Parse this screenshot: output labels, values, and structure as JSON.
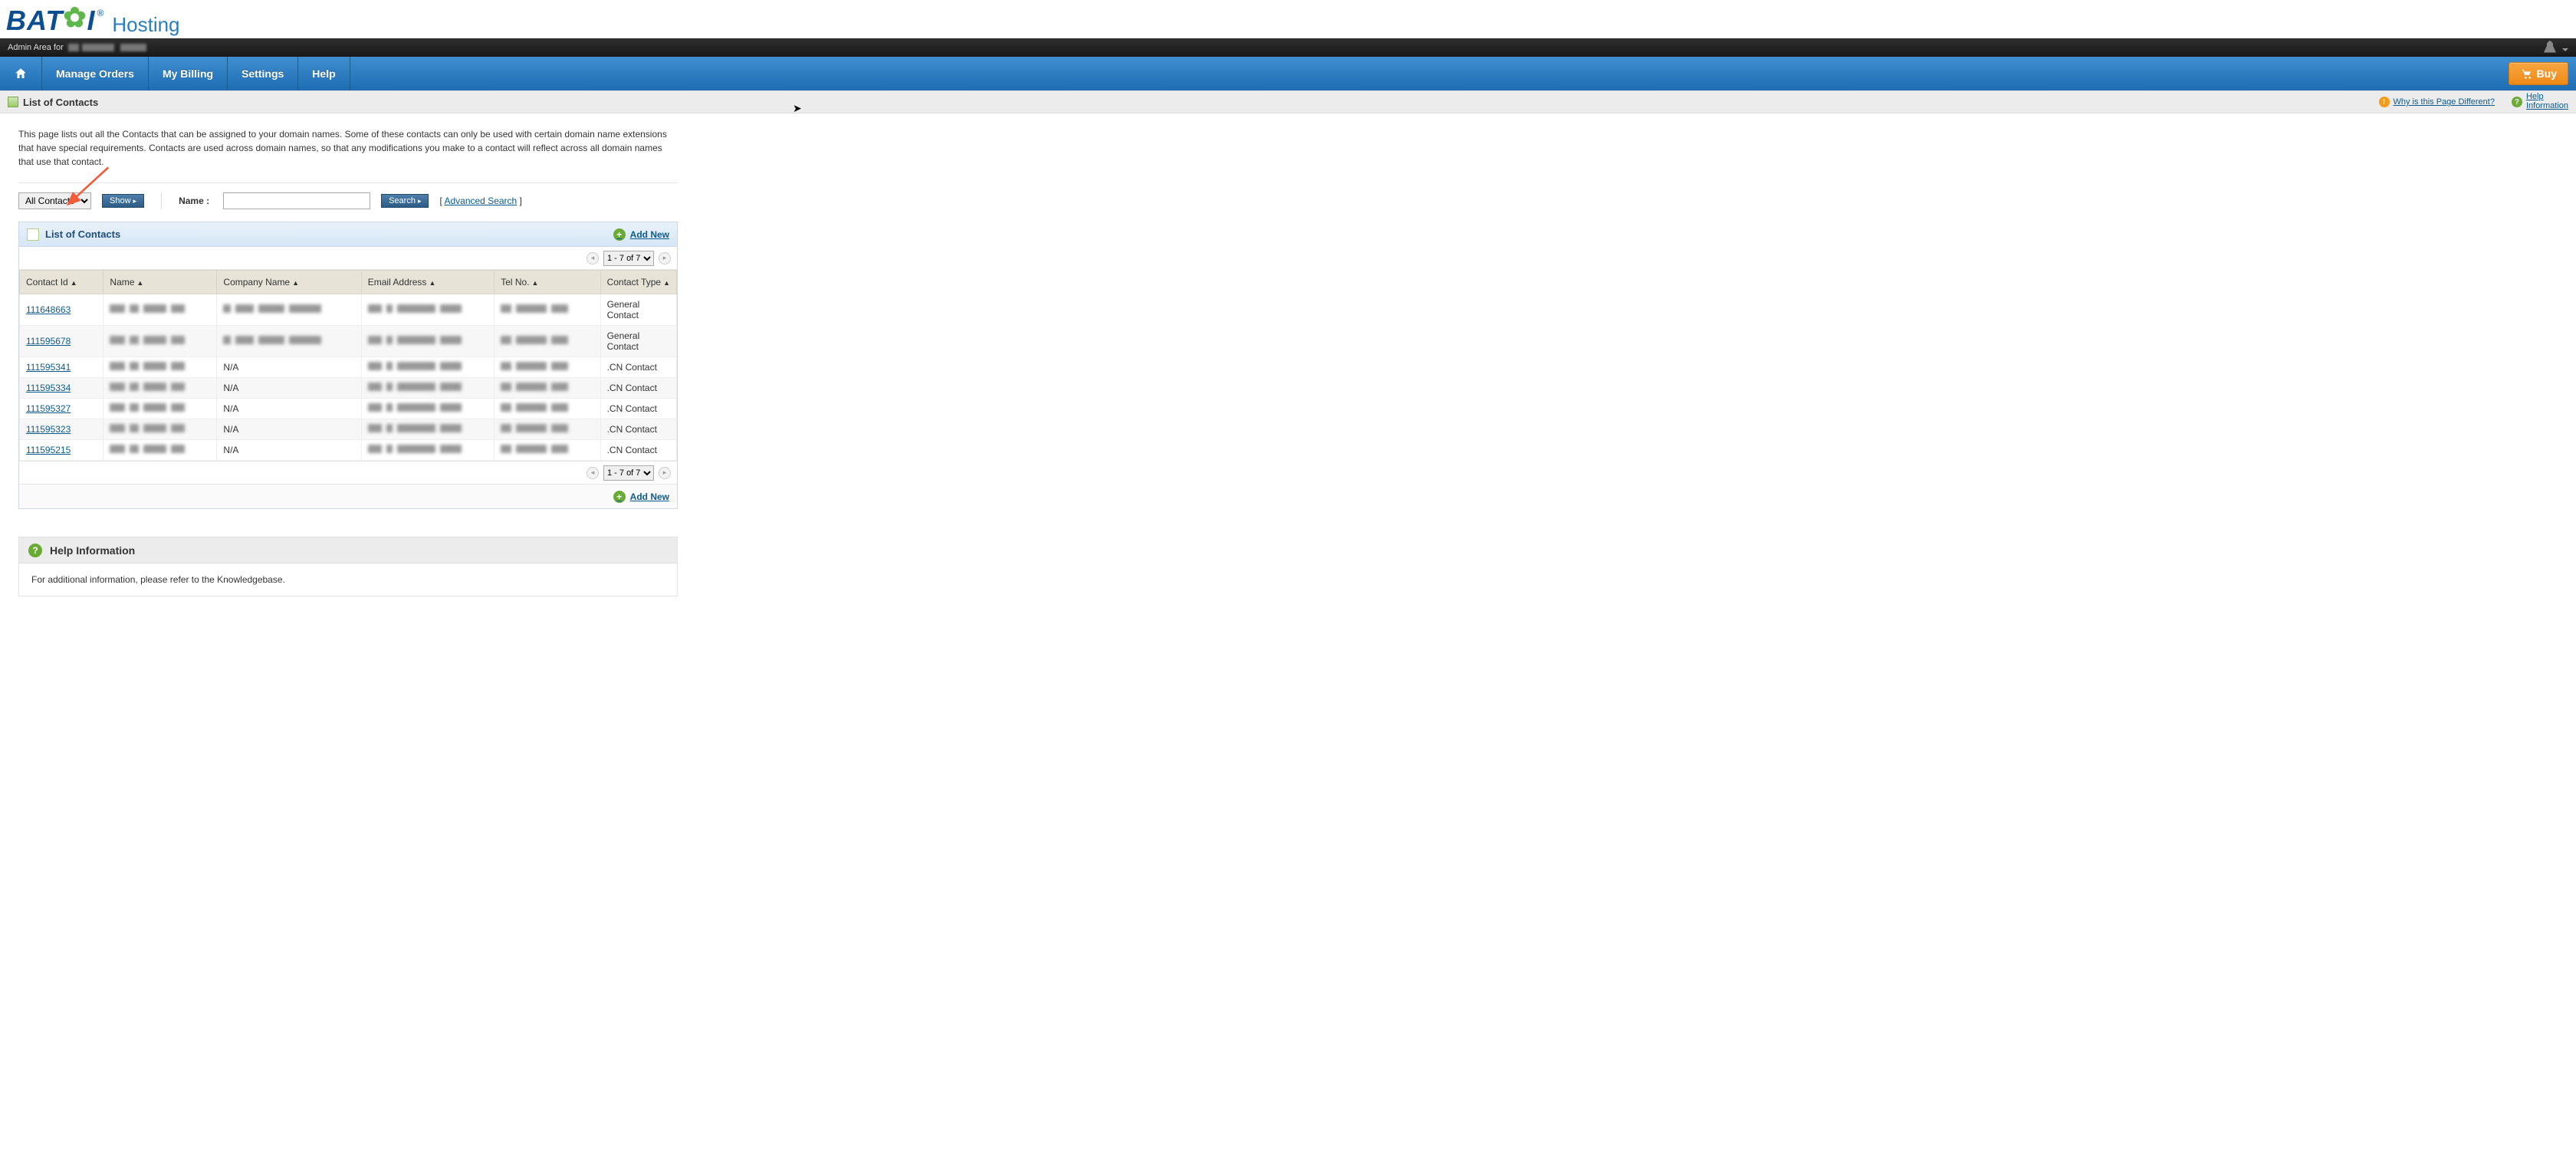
{
  "brand": {
    "name": "BATOI",
    "suffix": "Hosting"
  },
  "blackbar": {
    "prefix": "Admin Area for"
  },
  "nav": {
    "items": [
      "Manage Orders",
      "My Billing",
      "Settings",
      "Help"
    ],
    "buy": "Buy"
  },
  "pageheader": {
    "title": "List of Contacts",
    "why_link": "Why is this Page Different?",
    "help_link_l1": "Help",
    "help_link_l2": "Information"
  },
  "description": "This page lists out all the Contacts that can be assigned to your domain names. Some of these contacts can only be used with certain domain name extensions that have special requirements. Contacts are used across domain names, so that any modifications you make to a contact will reflect across all domain names that use that contact.",
  "filters": {
    "select_label": "All Contacts",
    "show_btn": "Show",
    "name_label": "Name :",
    "search_btn": "Search",
    "advanced": "Advanced Search"
  },
  "panel": {
    "title": "List of Contacts",
    "add_new": "Add New",
    "pager": "1 - 7 of 7"
  },
  "columns": {
    "id": "Contact Id",
    "name": "Name",
    "company": "Company Name",
    "email": "Email Address",
    "tel": "Tel No.",
    "type": "Contact Type"
  },
  "rows": [
    {
      "id": "111648663",
      "company": "",
      "type": "General Contact",
      "redacted": true
    },
    {
      "id": "111595678",
      "company": "",
      "type": "General Contact",
      "redacted": true
    },
    {
      "id": "111595341",
      "company": "N/A",
      "type": ".CN Contact",
      "redacted": true
    },
    {
      "id": "111595334",
      "company": "N/A",
      "type": ".CN Contact",
      "redacted": true
    },
    {
      "id": "111595327",
      "company": "N/A",
      "type": ".CN Contact",
      "redacted": true
    },
    {
      "id": "111595323",
      "company": "N/A",
      "type": ".CN Contact",
      "redacted": true
    },
    {
      "id": "111595215",
      "company": "N/A",
      "type": ".CN Contact",
      "redacted": true
    }
  ],
  "help": {
    "title": "Help Information",
    "body": "For additional information, please refer to the Knowledgebase."
  }
}
